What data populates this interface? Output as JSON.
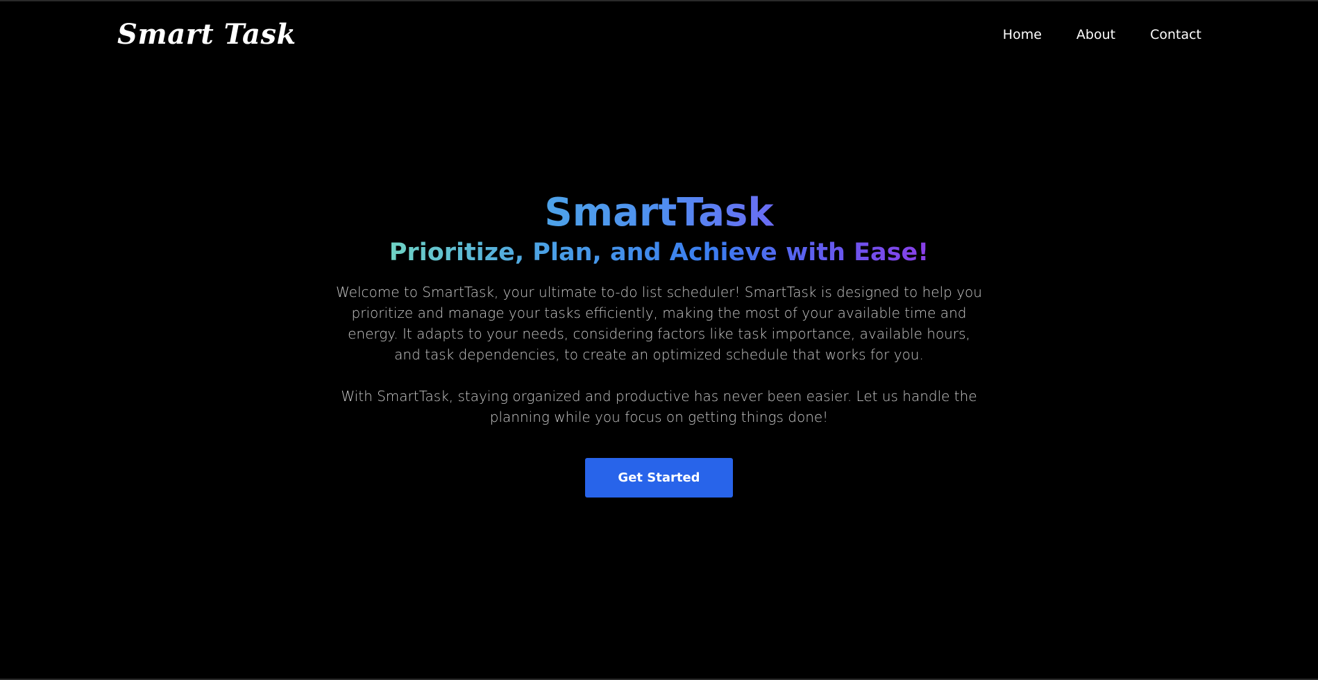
{
  "header": {
    "logo": "Smart Task",
    "nav": [
      {
        "label": "Home"
      },
      {
        "label": "About"
      },
      {
        "label": "Contact"
      }
    ]
  },
  "hero": {
    "title": "SmartTask",
    "subtitle": "Prioritize, Plan, and Achieve with Ease!",
    "paragraphs": [
      "Welcome to SmartTask, your ultimate to-do list scheduler! SmartTask is designed to help you prioritize and manage your tasks efficiently, making the most of your available time and energy. It adapts to your needs, considering factors like task importance, available hours, and task dependencies, to create an optimized schedule that works for you.",
      "With SmartTask, staying organized and productive has never been easier. Let us handle the planning while you focus on getting things done!"
    ],
    "cta_label": "Get Started"
  },
  "colors": {
    "background": "#000000",
    "accent": "#2864ea",
    "body_text": "#c9c9c9",
    "title_gradient": [
      "#4ea3e8",
      "#6a6cf3"
    ],
    "subtitle_gradient": [
      "#6fd3c4",
      "#8a3fe8"
    ]
  }
}
